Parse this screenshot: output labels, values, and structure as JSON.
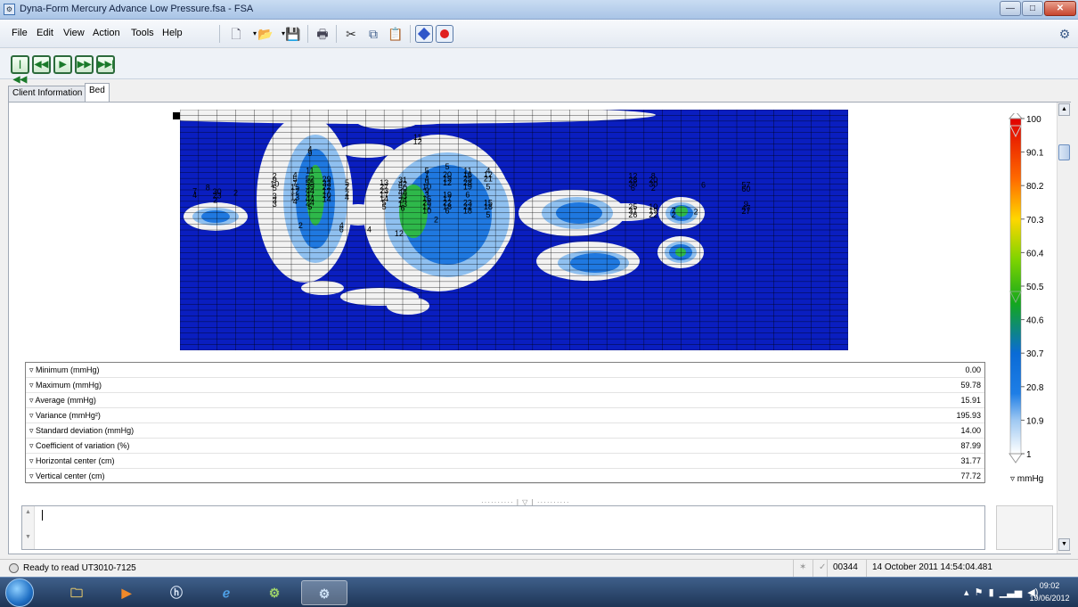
{
  "window": {
    "title": "Dyna-Form Mercury Advance Low Pressure.fsa - FSA",
    "min_glyph": "—",
    "max_glyph": "□",
    "close_glyph": "✕"
  },
  "menu": [
    "File",
    "Edit",
    "View",
    "Action",
    "Tools",
    "Help"
  ],
  "tabs": [
    {
      "label": "Client Information",
      "active": false
    },
    {
      "label": "Bed",
      "active": true
    }
  ],
  "heatmap": {
    "grid_cols": 36,
    "grid_rows": 42,
    "background": "#0a1ec0",
    "cells": [
      [
        23,
        35,
        0
      ],
      [
        23,
        35,
        4
      ],
      [
        23,
        35,
        8
      ],
      [
        23,
        35,
        12
      ],
      [
        40,
        49,
        2
      ],
      [
        40,
        49,
        11
      ],
      [
        40,
        49,
        12
      ],
      [
        40,
        49,
        9
      ],
      [
        50,
        75,
        5
      ],
      [
        50,
        75,
        6
      ],
      [
        50,
        75,
        7
      ],
      [
        50,
        75,
        7
      ],
      [
        50,
        75,
        6
      ],
      [
        50,
        75,
        5
      ],
      [
        50,
        75,
        4
      ]
    ],
    "labels": [
      {
        "t": "11",
        "gx": 12.8,
        "gy": 4.2
      },
      {
        "t": "12",
        "gx": 12.8,
        "gy": 5.0
      },
      {
        "t": "4",
        "gx": 7.0,
        "gy": 6.3
      },
      {
        "t": "9",
        "gx": 7.0,
        "gy": 7.0
      },
      {
        "t": "8",
        "gx": 1.5,
        "gy": 13.0
      },
      {
        "t": "7",
        "gx": 0.8,
        "gy": 13.6
      },
      {
        "t": "4",
        "gx": 0.8,
        "gy": 14.3
      },
      {
        "t": "30",
        "gx": 2.0,
        "gy": 13.7
      },
      {
        "t": "23",
        "gx": 2.0,
        "gy": 14.4
      },
      {
        "t": "2",
        "gx": 3.0,
        "gy": 13.9
      },
      {
        "t": "2",
        "gx": 1.9,
        "gy": 15.2
      },
      {
        "t": "2",
        "gx": 5.1,
        "gy": 11.0
      },
      {
        "t": "9",
        "gx": 5.1,
        "gy": 11.7
      },
      {
        "t": "10",
        "gx": 5.1,
        "gy": 12.4
      },
      {
        "t": "5",
        "gx": 5.1,
        "gy": 13.1
      },
      {
        "t": "4",
        "gx": 6.2,
        "gy": 10.8
      },
      {
        "t": "5",
        "gx": 6.2,
        "gy": 11.5
      },
      {
        "t": "7",
        "gx": 6.2,
        "gy": 12.2
      },
      {
        "t": "15",
        "gx": 6.2,
        "gy": 12.9
      },
      {
        "t": "12",
        "gx": 6.2,
        "gy": 13.6
      },
      {
        "t": "11",
        "gx": 7.0,
        "gy": 10.0
      },
      {
        "t": "52",
        "gx": 7.0,
        "gy": 11.4
      },
      {
        "t": "55",
        "gx": 7.0,
        "gy": 12.1
      },
      {
        "t": "39",
        "gx": 7.0,
        "gy": 12.8
      },
      {
        "t": "44",
        "gx": 7.0,
        "gy": 13.5
      },
      {
        "t": "47",
        "gx": 7.0,
        "gy": 14.2
      },
      {
        "t": "44",
        "gx": 7.0,
        "gy": 14.9
      },
      {
        "t": "24",
        "gx": 7.0,
        "gy": 15.6
      },
      {
        "t": "5",
        "gx": 7.0,
        "gy": 16.3
      },
      {
        "t": "29",
        "gx": 7.9,
        "gy": 11.5
      },
      {
        "t": "33",
        "gx": 7.9,
        "gy": 12.2
      },
      {
        "t": "22",
        "gx": 7.9,
        "gy": 12.9
      },
      {
        "t": "17",
        "gx": 7.9,
        "gy": 13.6
      },
      {
        "t": "10",
        "gx": 7.9,
        "gy": 14.3
      },
      {
        "t": "14",
        "gx": 7.9,
        "gy": 15.0
      },
      {
        "t": "5",
        "gx": 9.0,
        "gy": 12.1
      },
      {
        "t": "2",
        "gx": 9.0,
        "gy": 12.8
      },
      {
        "t": "2",
        "gx": 9.0,
        "gy": 14.0
      },
      {
        "t": "4",
        "gx": 9.0,
        "gy": 14.7
      },
      {
        "t": "3",
        "gx": 5.1,
        "gy": 14.5
      },
      {
        "t": "3",
        "gx": 5.1,
        "gy": 15.2
      },
      {
        "t": "3",
        "gx": 5.1,
        "gy": 15.9
      },
      {
        "t": "13",
        "gx": 6.2,
        "gy": 14.7
      },
      {
        "t": "4",
        "gx": 6.2,
        "gy": 15.4
      },
      {
        "t": "13",
        "gx": 11.0,
        "gy": 12.1
      },
      {
        "t": "27",
        "gx": 11.0,
        "gy": 12.8
      },
      {
        "t": "23",
        "gx": 11.0,
        "gy": 13.5
      },
      {
        "t": "17",
        "gx": 11.0,
        "gy": 14.2
      },
      {
        "t": "14",
        "gx": 11.0,
        "gy": 14.9
      },
      {
        "t": "5",
        "gx": 11.0,
        "gy": 15.6
      },
      {
        "t": "5",
        "gx": 11.0,
        "gy": 16.3
      },
      {
        "t": "31",
        "gx": 12.0,
        "gy": 11.7
      },
      {
        "t": "42",
        "gx": 12.0,
        "gy": 12.4
      },
      {
        "t": "50",
        "gx": 12.0,
        "gy": 13.1
      },
      {
        "t": "48",
        "gx": 12.0,
        "gy": 13.8
      },
      {
        "t": "33",
        "gx": 12.0,
        "gy": 14.5
      },
      {
        "t": "24",
        "gx": 12.0,
        "gy": 15.2
      },
      {
        "t": "13",
        "gx": 12.0,
        "gy": 15.9
      },
      {
        "t": "6",
        "gx": 12.0,
        "gy": 16.6
      },
      {
        "t": "5",
        "gx": 13.3,
        "gy": 10.0
      },
      {
        "t": "7",
        "gx": 13.3,
        "gy": 10.7
      },
      {
        "t": "4",
        "gx": 13.3,
        "gy": 11.4
      },
      {
        "t": "9",
        "gx": 13.3,
        "gy": 12.1
      },
      {
        "t": "10",
        "gx": 13.3,
        "gy": 12.8
      },
      {
        "t": "9",
        "gx": 13.3,
        "gy": 13.5
      },
      {
        "t": "3",
        "gx": 13.3,
        "gy": 14.2
      },
      {
        "t": "16",
        "gx": 13.3,
        "gy": 14.9
      },
      {
        "t": "28",
        "gx": 13.3,
        "gy": 15.6
      },
      {
        "t": "12",
        "gx": 13.3,
        "gy": 16.3
      },
      {
        "t": "10",
        "gx": 13.3,
        "gy": 17.0
      },
      {
        "t": "5",
        "gx": 14.4,
        "gy": 9.3
      },
      {
        "t": "20",
        "gx": 14.4,
        "gy": 10.7
      },
      {
        "t": "19",
        "gx": 14.4,
        "gy": 11.4
      },
      {
        "t": "12",
        "gx": 14.4,
        "gy": 12.1
      },
      {
        "t": "19",
        "gx": 14.4,
        "gy": 14.2
      },
      {
        "t": "17",
        "gx": 14.4,
        "gy": 14.9
      },
      {
        "t": "22",
        "gx": 14.4,
        "gy": 15.6
      },
      {
        "t": "18",
        "gx": 14.4,
        "gy": 16.3
      },
      {
        "t": "6",
        "gx": 14.4,
        "gy": 17.0
      },
      {
        "t": "11",
        "gx": 15.5,
        "gy": 10.0
      },
      {
        "t": "16",
        "gx": 15.5,
        "gy": 10.7
      },
      {
        "t": "25",
        "gx": 15.5,
        "gy": 11.4
      },
      {
        "t": "28",
        "gx": 15.5,
        "gy": 12.1
      },
      {
        "t": "19",
        "gx": 15.5,
        "gy": 12.8
      },
      {
        "t": "6",
        "gx": 15.5,
        "gy": 14.2
      },
      {
        "t": "23",
        "gx": 15.5,
        "gy": 15.6
      },
      {
        "t": "22",
        "gx": 15.5,
        "gy": 16.3
      },
      {
        "t": "18",
        "gx": 15.5,
        "gy": 17.0
      },
      {
        "t": "4",
        "gx": 16.6,
        "gy": 10.0
      },
      {
        "t": "12",
        "gx": 16.6,
        "gy": 10.7
      },
      {
        "t": "21",
        "gx": 16.6,
        "gy": 11.4
      },
      {
        "t": "5",
        "gx": 16.6,
        "gy": 12.8
      },
      {
        "t": "15",
        "gx": 16.6,
        "gy": 15.6
      },
      {
        "t": "18",
        "gx": 16.6,
        "gy": 16.3
      },
      {
        "t": "5",
        "gx": 16.6,
        "gy": 17.7
      },
      {
        "t": "2",
        "gx": 6.5,
        "gy": 19.6
      },
      {
        "t": "4",
        "gx": 8.7,
        "gy": 19.6
      },
      {
        "t": "6",
        "gx": 8.7,
        "gy": 20.3
      },
      {
        "t": "4",
        "gx": 10.2,
        "gy": 20.3
      },
      {
        "t": "12",
        "gx": 11.8,
        "gy": 21.0
      },
      {
        "t": "2",
        "gx": 13.8,
        "gy": 18.6
      },
      {
        "t": "12",
        "gx": 24.4,
        "gy": 11.0
      },
      {
        "t": "8",
        "gx": 25.5,
        "gy": 11.0
      },
      {
        "t": "28",
        "gx": 24.4,
        "gy": 11.7
      },
      {
        "t": "20",
        "gx": 25.5,
        "gy": 11.7
      },
      {
        "t": "36",
        "gx": 24.4,
        "gy": 12.4
      },
      {
        "t": "30",
        "gx": 25.5,
        "gy": 12.4
      },
      {
        "t": "6",
        "gx": 24.4,
        "gy": 13.1
      },
      {
        "t": "2",
        "gx": 25.5,
        "gy": 13.1
      },
      {
        "t": "6",
        "gx": 28.2,
        "gy": 12.5
      },
      {
        "t": "57",
        "gx": 30.5,
        "gy": 12.5
      },
      {
        "t": "60",
        "gx": 30.5,
        "gy": 13.2
      },
      {
        "t": "25",
        "gx": 24.4,
        "gy": 16.3
      },
      {
        "t": "10",
        "gx": 25.5,
        "gy": 16.3
      },
      {
        "t": "31",
        "gx": 24.4,
        "gy": 17.0
      },
      {
        "t": "19",
        "gx": 25.5,
        "gy": 17.0
      },
      {
        "t": "26",
        "gx": 24.4,
        "gy": 17.7
      },
      {
        "t": "22",
        "gx": 25.5,
        "gy": 17.7
      },
      {
        "t": "7",
        "gx": 26.6,
        "gy": 17.0
      },
      {
        "t": "2",
        "gx": 26.6,
        "gy": 17.7
      },
      {
        "t": "2",
        "gx": 27.8,
        "gy": 17.2
      },
      {
        "t": "9",
        "gx": 30.5,
        "gy": 15.9
      },
      {
        "t": "47",
        "gx": 30.5,
        "gy": 16.6
      },
      {
        "t": "27",
        "gx": 30.5,
        "gy": 17.1
      }
    ]
  },
  "stats": [
    {
      "label": "▿ Minimum (mmHg)",
      "value": "0.00"
    },
    {
      "label": "▿ Maximum (mmHg)",
      "value": "59.78"
    },
    {
      "label": "▿ Average (mmHg)",
      "value": "15.91"
    },
    {
      "label": "▿ Variance (mmHg²)",
      "value": "195.93"
    },
    {
      "label": "▿ Standard deviation (mmHg)",
      "value": "14.00"
    },
    {
      "label": "▿ Coefficient of variation (%)",
      "value": "87.99"
    },
    {
      "label": "▿ Horizontal center (cm)",
      "value": "31.77"
    },
    {
      "label": "▿ Vertical center (cm)",
      "value": "77.72"
    }
  ],
  "legend": {
    "ticks": [
      "100",
      "90.1",
      "80.2",
      "70.3",
      "60.4",
      "50.5",
      "40.6",
      "30.7",
      "20.8",
      "10.9",
      "1"
    ],
    "unit": "▿ mmHg",
    "colors": [
      "#e00000",
      "#ff6a00",
      "#ffd700",
      "#7fd400",
      "#13a81c",
      "#0a6bd6",
      "#9ec8f2",
      "#ffffff"
    ]
  },
  "splitter_text": "··········  |  ▽  |  ··········",
  "status": {
    "text": "Ready to read UT3010-7125",
    "frame": "00344",
    "timestamp": "14 October 2011 14:54:04.481"
  },
  "taskbar": {
    "clock_time": "09:02",
    "clock_date": "19/06/2012"
  }
}
